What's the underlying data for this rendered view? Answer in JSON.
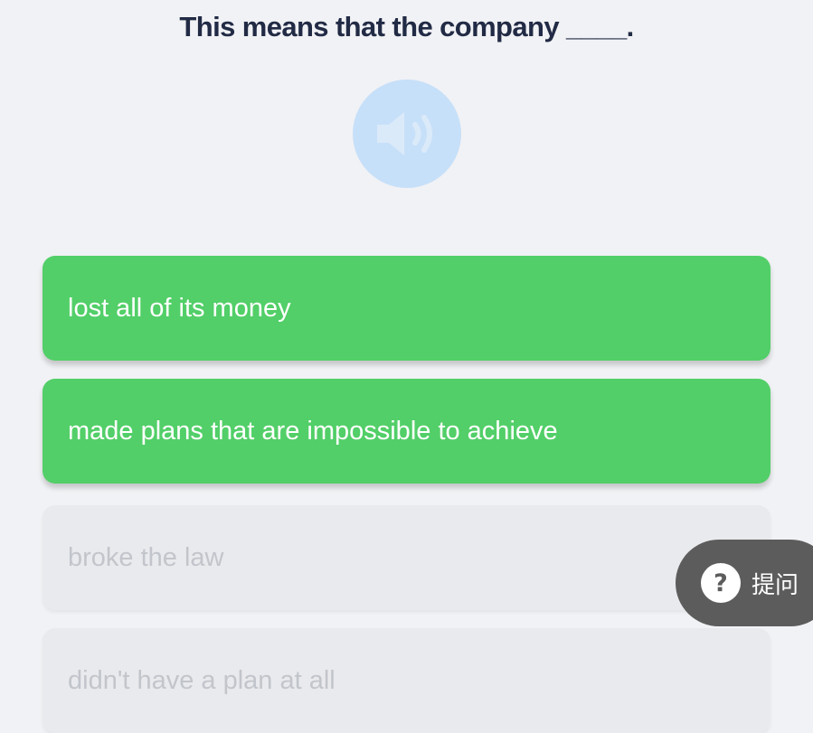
{
  "question": {
    "text": "This means that the company ____."
  },
  "audio": {
    "icon": "speaker-icon",
    "color": "#c7e0f9"
  },
  "options": [
    {
      "label": "lost all of its money",
      "state": "active"
    },
    {
      "label": "made plans that are impossible to achieve",
      "state": "active"
    },
    {
      "label": "broke the law",
      "state": "disabled"
    },
    {
      "label": "didn't have a plan at all",
      "state": "disabled"
    }
  ],
  "hint": {
    "icon": "question-mark-icon",
    "label": "提问"
  },
  "colors": {
    "background": "#f1f2f5",
    "active_option": "#52cf68",
    "disabled_option": "#e9eaed",
    "question_text": "#222b45",
    "hint_button": "#5c5c5c"
  }
}
